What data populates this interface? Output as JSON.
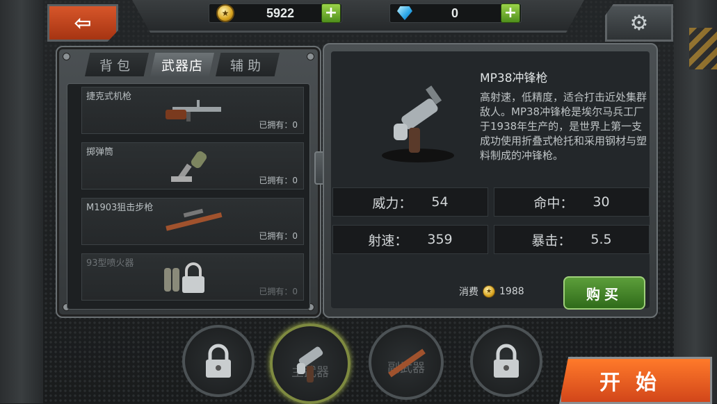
{
  "currency": {
    "coins": "5922",
    "gems": "0"
  },
  "tabs": [
    {
      "label": "背包",
      "active": false
    },
    {
      "label": "武器店",
      "active": true
    },
    {
      "label": "辅助",
      "active": false
    }
  ],
  "weapon_list": [
    {
      "name": "捷克式机枪",
      "owned": "已拥有：0",
      "icon": "machine-gun-icon"
    },
    {
      "name": "掷弹筒",
      "owned": "已拥有：0",
      "icon": "grenade-launcher-icon"
    },
    {
      "name": "M1903狙击步枪",
      "owned": "已拥有：0",
      "icon": "sniper-rifle-icon"
    },
    {
      "name": "93型喷火器",
      "owned": "已拥有：0",
      "icon": "flamethrower-icon",
      "locked": true
    }
  ],
  "detail": {
    "title": "MP38冲锋枪",
    "description": "高射速，低精度，适合打击近处集群敌人。MP38冲锋枪是埃尔马兵工厂于1938年生产的，是世界上第一支成功使用折叠式枪托和采用钢材与塑料制成的冲锋枪。",
    "stats": [
      {
        "label": "威力：",
        "value": "54"
      },
      {
        "label": "命中：",
        "value": "30"
      },
      {
        "label": "射速：",
        "value": "359"
      },
      {
        "label": "暴击：",
        "value": "5.5"
      }
    ],
    "cost_label": "消费",
    "cost_value": "1988",
    "buy_label": "购买"
  },
  "slots": [
    {
      "label": "",
      "locked": true
    },
    {
      "label": "主武器",
      "selected": true
    },
    {
      "label": "副武器"
    },
    {
      "label": "",
      "locked": true
    }
  ],
  "start_label": "开始",
  "colors": {
    "accent_orange": "#e05a22",
    "buy_green": "#4a8a2a",
    "coin_gold": "#d9a520"
  }
}
